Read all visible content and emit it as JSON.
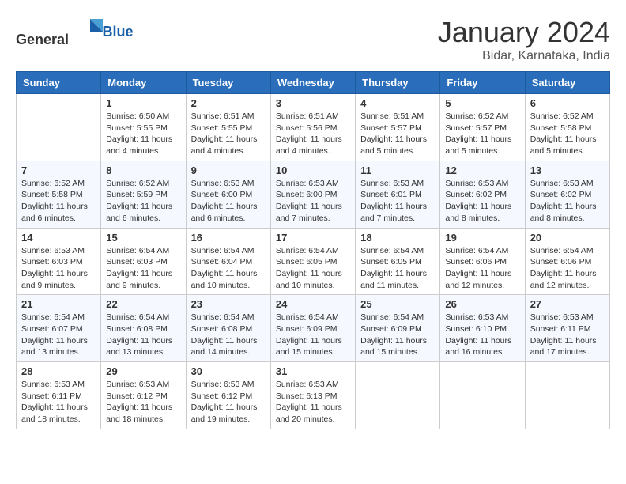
{
  "header": {
    "logo_general": "General",
    "logo_blue": "Blue",
    "month_title": "January 2024",
    "location": "Bidar, Karnataka, India"
  },
  "weekdays": [
    "Sunday",
    "Monday",
    "Tuesday",
    "Wednesday",
    "Thursday",
    "Friday",
    "Saturday"
  ],
  "weeks": [
    [
      {
        "day": "",
        "sunrise": "",
        "sunset": "",
        "daylight": ""
      },
      {
        "day": "1",
        "sunrise": "Sunrise: 6:50 AM",
        "sunset": "Sunset: 5:55 PM",
        "daylight": "Daylight: 11 hours and 4 minutes."
      },
      {
        "day": "2",
        "sunrise": "Sunrise: 6:51 AM",
        "sunset": "Sunset: 5:55 PM",
        "daylight": "Daylight: 11 hours and 4 minutes."
      },
      {
        "day": "3",
        "sunrise": "Sunrise: 6:51 AM",
        "sunset": "Sunset: 5:56 PM",
        "daylight": "Daylight: 11 hours and 4 minutes."
      },
      {
        "day": "4",
        "sunrise": "Sunrise: 6:51 AM",
        "sunset": "Sunset: 5:57 PM",
        "daylight": "Daylight: 11 hours and 5 minutes."
      },
      {
        "day": "5",
        "sunrise": "Sunrise: 6:52 AM",
        "sunset": "Sunset: 5:57 PM",
        "daylight": "Daylight: 11 hours and 5 minutes."
      },
      {
        "day": "6",
        "sunrise": "Sunrise: 6:52 AM",
        "sunset": "Sunset: 5:58 PM",
        "daylight": "Daylight: 11 hours and 5 minutes."
      }
    ],
    [
      {
        "day": "7",
        "sunrise": "Sunrise: 6:52 AM",
        "sunset": "Sunset: 5:58 PM",
        "daylight": "Daylight: 11 hours and 6 minutes."
      },
      {
        "day": "8",
        "sunrise": "Sunrise: 6:52 AM",
        "sunset": "Sunset: 5:59 PM",
        "daylight": "Daylight: 11 hours and 6 minutes."
      },
      {
        "day": "9",
        "sunrise": "Sunrise: 6:53 AM",
        "sunset": "Sunset: 6:00 PM",
        "daylight": "Daylight: 11 hours and 6 minutes."
      },
      {
        "day": "10",
        "sunrise": "Sunrise: 6:53 AM",
        "sunset": "Sunset: 6:00 PM",
        "daylight": "Daylight: 11 hours and 7 minutes."
      },
      {
        "day": "11",
        "sunrise": "Sunrise: 6:53 AM",
        "sunset": "Sunset: 6:01 PM",
        "daylight": "Daylight: 11 hours and 7 minutes."
      },
      {
        "day": "12",
        "sunrise": "Sunrise: 6:53 AM",
        "sunset": "Sunset: 6:02 PM",
        "daylight": "Daylight: 11 hours and 8 minutes."
      },
      {
        "day": "13",
        "sunrise": "Sunrise: 6:53 AM",
        "sunset": "Sunset: 6:02 PM",
        "daylight": "Daylight: 11 hours and 8 minutes."
      }
    ],
    [
      {
        "day": "14",
        "sunrise": "Sunrise: 6:53 AM",
        "sunset": "Sunset: 6:03 PM",
        "daylight": "Daylight: 11 hours and 9 minutes."
      },
      {
        "day": "15",
        "sunrise": "Sunrise: 6:54 AM",
        "sunset": "Sunset: 6:03 PM",
        "daylight": "Daylight: 11 hours and 9 minutes."
      },
      {
        "day": "16",
        "sunrise": "Sunrise: 6:54 AM",
        "sunset": "Sunset: 6:04 PM",
        "daylight": "Daylight: 11 hours and 10 minutes."
      },
      {
        "day": "17",
        "sunrise": "Sunrise: 6:54 AM",
        "sunset": "Sunset: 6:05 PM",
        "daylight": "Daylight: 11 hours and 10 minutes."
      },
      {
        "day": "18",
        "sunrise": "Sunrise: 6:54 AM",
        "sunset": "Sunset: 6:05 PM",
        "daylight": "Daylight: 11 hours and 11 minutes."
      },
      {
        "day": "19",
        "sunrise": "Sunrise: 6:54 AM",
        "sunset": "Sunset: 6:06 PM",
        "daylight": "Daylight: 11 hours and 12 minutes."
      },
      {
        "day": "20",
        "sunrise": "Sunrise: 6:54 AM",
        "sunset": "Sunset: 6:06 PM",
        "daylight": "Daylight: 11 hours and 12 minutes."
      }
    ],
    [
      {
        "day": "21",
        "sunrise": "Sunrise: 6:54 AM",
        "sunset": "Sunset: 6:07 PM",
        "daylight": "Daylight: 11 hours and 13 minutes."
      },
      {
        "day": "22",
        "sunrise": "Sunrise: 6:54 AM",
        "sunset": "Sunset: 6:08 PM",
        "daylight": "Daylight: 11 hours and 13 minutes."
      },
      {
        "day": "23",
        "sunrise": "Sunrise: 6:54 AM",
        "sunset": "Sunset: 6:08 PM",
        "daylight": "Daylight: 11 hours and 14 minutes."
      },
      {
        "day": "24",
        "sunrise": "Sunrise: 6:54 AM",
        "sunset": "Sunset: 6:09 PM",
        "daylight": "Daylight: 11 hours and 15 minutes."
      },
      {
        "day": "25",
        "sunrise": "Sunrise: 6:54 AM",
        "sunset": "Sunset: 6:09 PM",
        "daylight": "Daylight: 11 hours and 15 minutes."
      },
      {
        "day": "26",
        "sunrise": "Sunrise: 6:53 AM",
        "sunset": "Sunset: 6:10 PM",
        "daylight": "Daylight: 11 hours and 16 minutes."
      },
      {
        "day": "27",
        "sunrise": "Sunrise: 6:53 AM",
        "sunset": "Sunset: 6:11 PM",
        "daylight": "Daylight: 11 hours and 17 minutes."
      }
    ],
    [
      {
        "day": "28",
        "sunrise": "Sunrise: 6:53 AM",
        "sunset": "Sunset: 6:11 PM",
        "daylight": "Daylight: 11 hours and 18 minutes."
      },
      {
        "day": "29",
        "sunrise": "Sunrise: 6:53 AM",
        "sunset": "Sunset: 6:12 PM",
        "daylight": "Daylight: 11 hours and 18 minutes."
      },
      {
        "day": "30",
        "sunrise": "Sunrise: 6:53 AM",
        "sunset": "Sunset: 6:12 PM",
        "daylight": "Daylight: 11 hours and 19 minutes."
      },
      {
        "day": "31",
        "sunrise": "Sunrise: 6:53 AM",
        "sunset": "Sunset: 6:13 PM",
        "daylight": "Daylight: 11 hours and 20 minutes."
      },
      {
        "day": "",
        "sunrise": "",
        "sunset": "",
        "daylight": ""
      },
      {
        "day": "",
        "sunrise": "",
        "sunset": "",
        "daylight": ""
      },
      {
        "day": "",
        "sunrise": "",
        "sunset": "",
        "daylight": ""
      }
    ]
  ]
}
